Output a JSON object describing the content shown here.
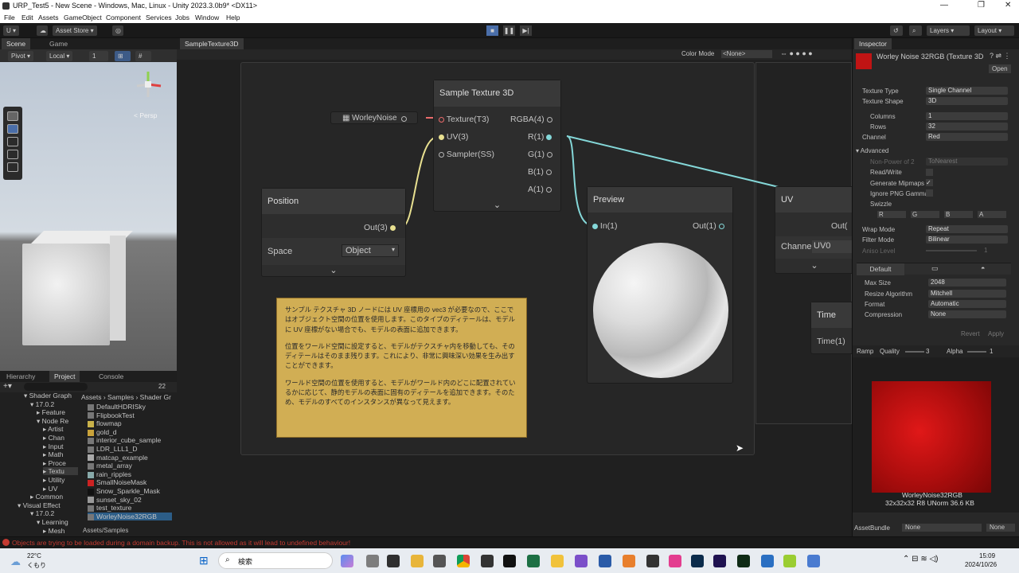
{
  "window": {
    "title": "URP_Test5 - New Scene - Windows, Mac, Linux - Unity 2023.3.0b9* <DX11>",
    "controls": [
      "—",
      "❐",
      "✕"
    ]
  },
  "menu": [
    "File",
    "Edit",
    "Assets",
    "GameObject",
    "Component",
    "Services",
    "Jobs",
    "Window",
    "Help"
  ],
  "toolbar": {
    "account": "U ▾",
    "asset_store": "Asset Store ▾",
    "layers": "Layers ▾",
    "layout": "Layout ▾"
  },
  "scene": {
    "tabs": [
      "Scene",
      "Game"
    ],
    "pivot": "Pivot ▾",
    "local": "Local ▾",
    "grid_size": "1",
    "persp": "< Persp"
  },
  "project": {
    "tabs": [
      "Hierarchy",
      "Project",
      "Console"
    ],
    "count": "22",
    "breadcrumb": "Assets › Samples › Shader Gr",
    "tree": [
      "▾ Shader Graph",
      "▾ 17.0.2",
      "▸ Feature",
      "▾ Node Re",
      "▸ Artist",
      "▸ Chan",
      "▸ Input",
      "▸ Math",
      "▸ Proce",
      "▸ Textu",
      "▸ Utility",
      "▸ UV",
      "▸ Common",
      "▾ Visual Effect",
      "▾ 17.0.2",
      "▾ Learning",
      "▸ Mesh"
    ],
    "files": [
      "DefaultHDRISky",
      "FlipbookTest",
      "flowmap",
      "gold_d",
      "interior_cube_sample",
      "LDR_LLL1_D",
      "matcap_example",
      "metal_array",
      "rain_ripples",
      "SmallNoiseMask",
      "Snow_Sparkle_Mask",
      "sunset_sky_02",
      "test_texture",
      "WorleyNoise32RGB"
    ],
    "footer": "Assets/Samples"
  },
  "graph": {
    "tab": "SampleTexture3D",
    "color_mode_label": "Color Mode",
    "color_mode": "<None>",
    "property_node": "WorleyNoise",
    "sample_node": {
      "title": "Sample Texture 3D",
      "inputs": [
        "Texture(T3)",
        "UV(3)",
        "Sampler(SS)"
      ],
      "outputs": [
        "RGBA(4)",
        "R(1)",
        "G(1)",
        "B(1)",
        "A(1)"
      ]
    },
    "position_node": {
      "title": "Position",
      "output": "Out(3)",
      "space_label": "Space",
      "space_value": "Object"
    },
    "preview_node": {
      "title": "Preview",
      "input": "In(1)",
      "output": "Out(1)"
    },
    "uv_node": {
      "title": "UV",
      "output": "Out(",
      "channel_label": "Channe",
      "channel_value": "UV0"
    },
    "time_node": {
      "title": "Time",
      "output": "Time(1)"
    },
    "note": [
      "サンプル テクスチャ 3D ノードには UV 座標用の vec3 が必要なので、ここではオブジェクト空間の位置を使用します。このタイプのディテールは、モデルに UV 座標がない場合でも、モデルの表面に追加できます。",
      "位置をワールド空間に設定すると、モデルがテクスチャ内を移動しても、そのディテールはそのまま残ります。これにより、非常に興味深い効果を生み出すことができます。",
      "ワールド空間の位置を使用すると、モデルがワールド内のどこに配置されているかに応じて、静的モデルの表面に固有のディテールを追加できます。そのため、モデルのすべてのインスタンスが異なって見えます。"
    ]
  },
  "inspector": {
    "tab": "Inspector",
    "asset_title": "Worley Noise 32RGB (Texture 3D",
    "open": "Open",
    "rows": [
      [
        "Texture Type",
        "Single Channel"
      ],
      [
        "Texture Shape",
        "3D"
      ],
      [
        "Columns",
        "1"
      ],
      [
        "Rows",
        "32"
      ],
      [
        "Channel",
        "Red"
      ]
    ],
    "advanced": "▾ Advanced",
    "adv_rows": [
      "Non-Power of 2",
      "Read/Write",
      "Generate Mipmaps",
      "Ignore PNG Gamma",
      "Swizzle"
    ],
    "npot": "ToNearest",
    "swizzle": [
      "R",
      "G",
      "B",
      "A"
    ],
    "wrap_label": "Wrap Mode",
    "wrap": "Repeat",
    "filter_label": "Filter Mode",
    "filter": "Bilinear",
    "aniso_label": "Aniso Level",
    "aniso": "1",
    "platform": "Default",
    "platform_rows": [
      [
        "Max Size",
        "2048"
      ],
      [
        "Resize Algorithm",
        "Mitchell"
      ],
      [
        "Format",
        "Automatic"
      ],
      [
        "Compression",
        "None"
      ]
    ],
    "revert": "Revert",
    "apply": "Apply",
    "preview_bar": {
      "ramp": "Ramp",
      "quality": "Quality",
      "quality_val": "3",
      "alpha": "Alpha",
      "alpha_val": "1"
    },
    "preview_name": "WorleyNoise32RGB",
    "preview_info": "32x32x32 R8 UNorm 36.6 KB",
    "assetbundle": "AssetBundle",
    "assetbundle_val": "None",
    "assetbundle_variant": "None"
  },
  "status": "Objects are trying to be loaded during a domain backup. This is not allowed as it will lead to undefined behaviour!",
  "taskbar": {
    "temp": "22°C",
    "weather": "くもり",
    "search": "検索",
    "time": "15:09",
    "date": "2024/10/26"
  }
}
